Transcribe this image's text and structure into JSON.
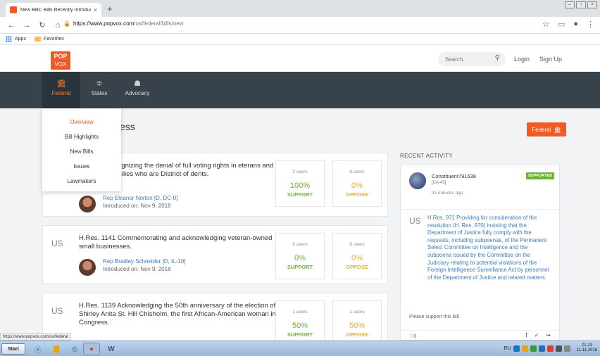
{
  "browser": {
    "tab_title": "New Bills: Bills Recently Introduced",
    "tab_close": "×",
    "new_tab": "+",
    "url_host": "https://www.popvox.com",
    "url_path": "/us/federal/bills/new",
    "bookmarks": [
      "Apps",
      "Favorites"
    ]
  },
  "header": {
    "logo_top": "POP",
    "logo_bottom": "VOX",
    "search_placeholder": "Search...",
    "login": "Login",
    "signup": "Sign Up"
  },
  "nav": [
    {
      "label": "Federal",
      "icon": "bank-icon"
    },
    {
      "label": "States",
      "icon": "signpost-icon"
    },
    {
      "label": "Advocacy",
      "icon": "people-icon"
    }
  ],
  "dropdown": [
    "Overview",
    "Bill Highlights",
    "New Bills",
    "Issues",
    "Lawmakers"
  ],
  "main": {
    "title_suffix": "ess",
    "federal_button": "Federal"
  },
  "bills": [
    {
      "jurisdiction": "",
      "title": "ecognizing the denial of full voting rights in eterans and their families who are District of dents.",
      "sponsor": "Rep Eleanor Norton [D, DC-0]",
      "introduced": "Introduced on: Nov 9, 2018",
      "support_users": "2 users",
      "support_pct": "100%",
      "support_label": "SUPPORT",
      "oppose_users": "0 users",
      "oppose_pct": "0%",
      "oppose_label": "OPPOSE"
    },
    {
      "jurisdiction": "US",
      "title": "H.Res. 1141 Commemorating and acknowledging veteran-owned small businesses.",
      "sponsor": "Rep Bradley Schneider [D, IL-10]",
      "introduced": "Introduced on: Nov 9, 2018",
      "support_users": "0 users",
      "support_pct": "0%",
      "support_label": "SUPPORT",
      "oppose_users": "0 users",
      "oppose_pct": "0%",
      "oppose_label": "OPPOSE"
    },
    {
      "jurisdiction": "US",
      "title": "H.Res. 1139 Acknowledging the 50th anniversary of the election of Shirley Anita St. Hill Chisholm, the first African-American woman in Congress.",
      "sponsor": "",
      "introduced": "",
      "support_users": "1 users",
      "support_pct": "50%",
      "support_label": "SUPPORT",
      "oppose_users": "1 users",
      "oppose_pct": "50%",
      "oppose_label": "OPPOSE"
    }
  ],
  "recent": {
    "title": "RECENT ACTIVITY",
    "user": "Constituent791638",
    "district": "[CA-43]",
    "time": "31 minutes ago",
    "badge": "SUPPORTED",
    "jurisdiction": "US",
    "bill_text": "H.Res. 971 Providing for consideration of the resolution (H. Res. 970) insisting that the Department of Justice fully comply with the requests, including subpoenas, of the Permanent Select Committee on Intelligence and the subpoena issued by the Committee on the Judiciary relating to potential violations of the Foreign Intelligence Surveillance Act by personnel of the Department of Justice and related matters.",
    "message": "Please support this Bill.",
    "likes": "♡0",
    "share": [
      "f",
      "✓",
      "↪"
    ]
  },
  "status_url": "https://www.popvox.com/us/federal",
  "taskbar": {
    "start": "Start",
    "lang": "RU",
    "time": "21:23",
    "date": "11.11.2018"
  },
  "colors": {
    "brand": "#f15a24",
    "nav_bg": "#37424b",
    "support": "#6fb52c",
    "oppose": "#e0b32a",
    "link": "#3b7bbf"
  }
}
